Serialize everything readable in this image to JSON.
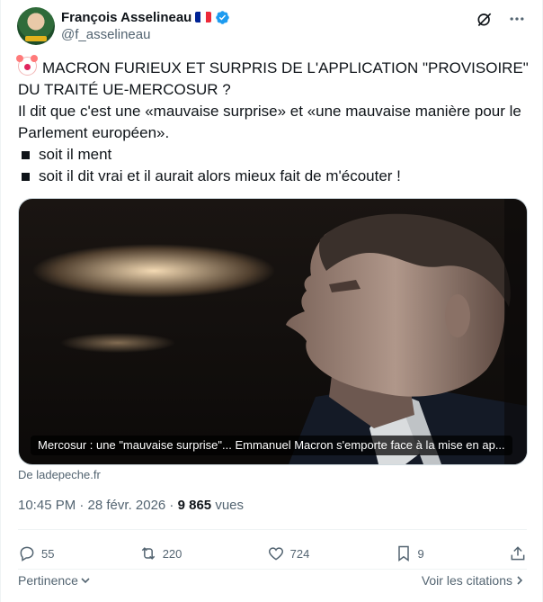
{
  "author": {
    "display_name": "François Asselineau",
    "handle": "@f_asselineau",
    "flag_colors": [
      "#002395",
      "#ffffff",
      "#ED2939"
    ],
    "verified_color": "#1d9bf0"
  },
  "header_icons": [
    "grok-icon",
    "more-icon"
  ],
  "tweet": {
    "line1": "MACRON FURIEUX ET SURPRIS DE L'APPLICATION \"PROVISOIRE\" DU TRAITÉ UE-MERCOSUR ?",
    "line2": "Il dit que c'est une «mauvaise surprise» et «une mauvaise manière pour le Parlement européen».",
    "bullets": [
      "soit il ment",
      "soit il dit vrai et il aurait alors mieux fait de m'écouter !"
    ]
  },
  "card": {
    "caption": "Mercosur : une \"mauvaise surprise\"... Emmanuel Macron s'emporte face à la mise en ap...",
    "source": "De ladepeche.fr"
  },
  "meta": {
    "time_date": "10:45 PM · 28 févr. 2026 · ",
    "views_count": "9 865",
    "views_label": " vues"
  },
  "actions": {
    "replies": "55",
    "reposts": "220",
    "likes": "724",
    "bookmarks": "9"
  },
  "footer": {
    "sort_label": "Pertinence",
    "quotes_label": "Voir les citations"
  },
  "colors": {
    "text": "#0f1419",
    "secondary": "#536471",
    "border": "#eff3f4"
  }
}
